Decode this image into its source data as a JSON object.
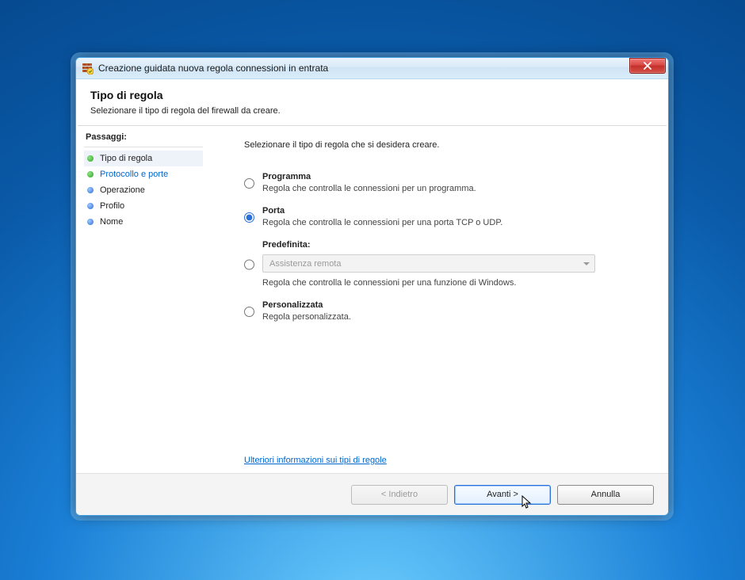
{
  "window": {
    "title": "Creazione guidata nuova regola connessioni in entrata"
  },
  "header": {
    "title": "Tipo di regola",
    "subtitle": "Selezionare il tipo di regola del firewall da creare."
  },
  "sidebar": {
    "title": "Passaggi:",
    "steps": [
      {
        "label": "Tipo di regola"
      },
      {
        "label": "Protocollo e porte"
      },
      {
        "label": "Operazione"
      },
      {
        "label": "Profilo"
      },
      {
        "label": "Nome"
      }
    ]
  },
  "main": {
    "intro": "Selezionare il tipo di regola che si desidera creare.",
    "options": {
      "programma": {
        "label": "Programma",
        "desc": "Regola che controlla le connessioni per un programma."
      },
      "porta": {
        "label": "Porta",
        "desc": "Regola che controlla le connessioni per una porta TCP o UDP."
      },
      "predefinita": {
        "label": "Predefinita:",
        "dropdown": "Assistenza remota",
        "desc": "Regola che controlla le connessioni per una funzione di Windows."
      },
      "personalizzata": {
        "label": "Personalizzata",
        "desc": "Regola personalizzata."
      }
    },
    "more_link": "Ulteriori informazioni sui tipi di regole"
  },
  "footer": {
    "back": "< Indietro",
    "next": "Avanti >",
    "cancel": "Annulla"
  }
}
